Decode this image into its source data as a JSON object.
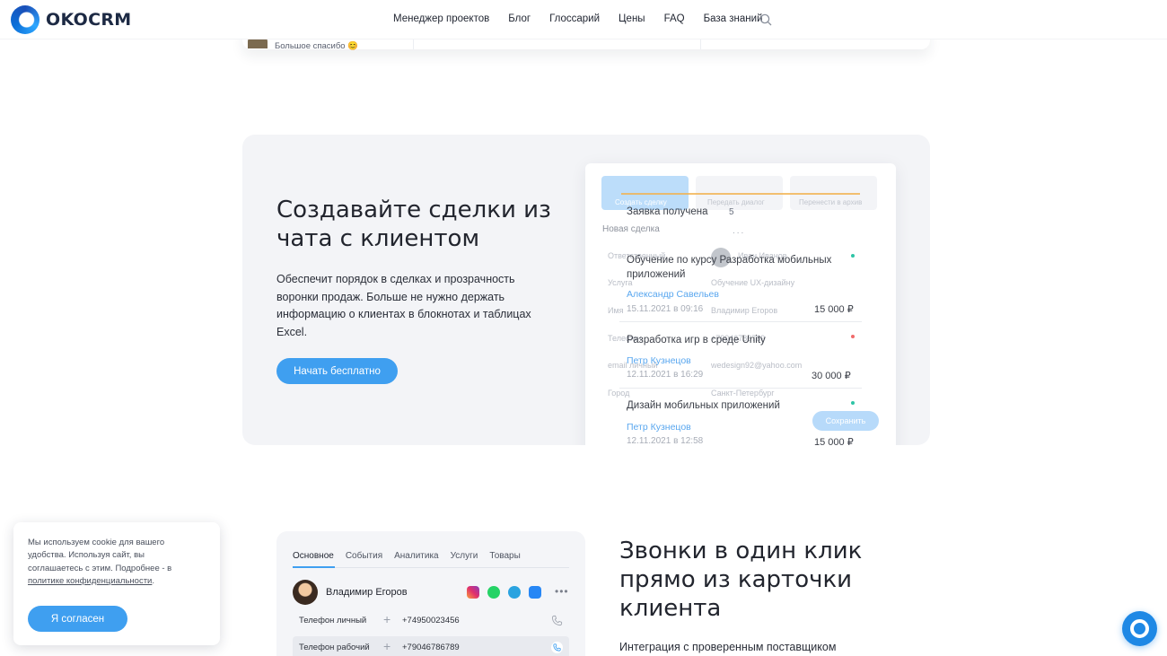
{
  "header": {
    "logo_text": "OKOCRM",
    "nav": [
      "Менеджер проектов",
      "Блог",
      "Глоссарий",
      "Цены",
      "FAQ",
      "База знаний"
    ]
  },
  "remnant": {
    "message": "Большое спасибо 😊"
  },
  "feature_deals": {
    "title": "Создавайте сделки из чата с клиентом",
    "description": "Обеспечит порядок в сделках и прозрачность воронки продаж. Больше не нужно держать информацию о клиентах в блокнотах и таблицах Excel.",
    "button": "Начать бесплатно",
    "mock": {
      "stages": [
        "Создать сделку",
        "Передать диалог",
        "Перенести в архив"
      ],
      "form_title": "Новая сделка",
      "fields": [
        {
          "label": "Ответственный",
          "value": "Иван Иванов"
        },
        {
          "label": "Услуга",
          "value": "Обучение UX-дизайну"
        },
        {
          "label": "Имя",
          "value": "Владимир Егоров"
        },
        {
          "label": "Телефон",
          "value": "+79046786789"
        },
        {
          "label": "email личный",
          "value": "wedesign92@yahoo.com"
        },
        {
          "label": "Город",
          "value": "Санкт-Петербург"
        }
      ],
      "column_title": "Заявка получена",
      "column_count": "5",
      "column_more": "...",
      "cards": [
        {
          "title": "Обучение по курсу Разработка мобильных приложений",
          "person": "Александр Савельев",
          "date": "15.11.2021 в 09:16",
          "price": "15 000 ₽"
        },
        {
          "title": "Разработка игр в среде Unity",
          "person": "Петр Кузнецов",
          "date": "12.11.2021 в 16:29",
          "price": "30 000 ₽"
        },
        {
          "title": "Дизайн мобильных приложений",
          "person": "Петр Кузнецов",
          "date": "12.11.2021 в 12:58",
          "price": "15 000 ₽"
        }
      ],
      "save_button": "Сохранить"
    }
  },
  "cookie": {
    "text": "Мы используем cookie для вашего удобства. Используя сайт, вы соглашаетесь с этим. Подробнее - в ",
    "link": "политике конфиденциальности",
    "text_end": ".",
    "button": "Я согласен"
  },
  "feature_calls": {
    "tabs": [
      "Основное",
      "События",
      "Аналитика",
      "Услуги",
      "Товары"
    ],
    "client_name": "Владимир Егоров",
    "phones": [
      {
        "label": "Телефон личный",
        "number": "+74950023456"
      },
      {
        "label": "Телефон рабочий",
        "number": "+79046786789"
      }
    ],
    "title": "Звонки в один клик прямо из карточки клиента",
    "description": "Интеграция с проверенным поставщиком"
  }
}
